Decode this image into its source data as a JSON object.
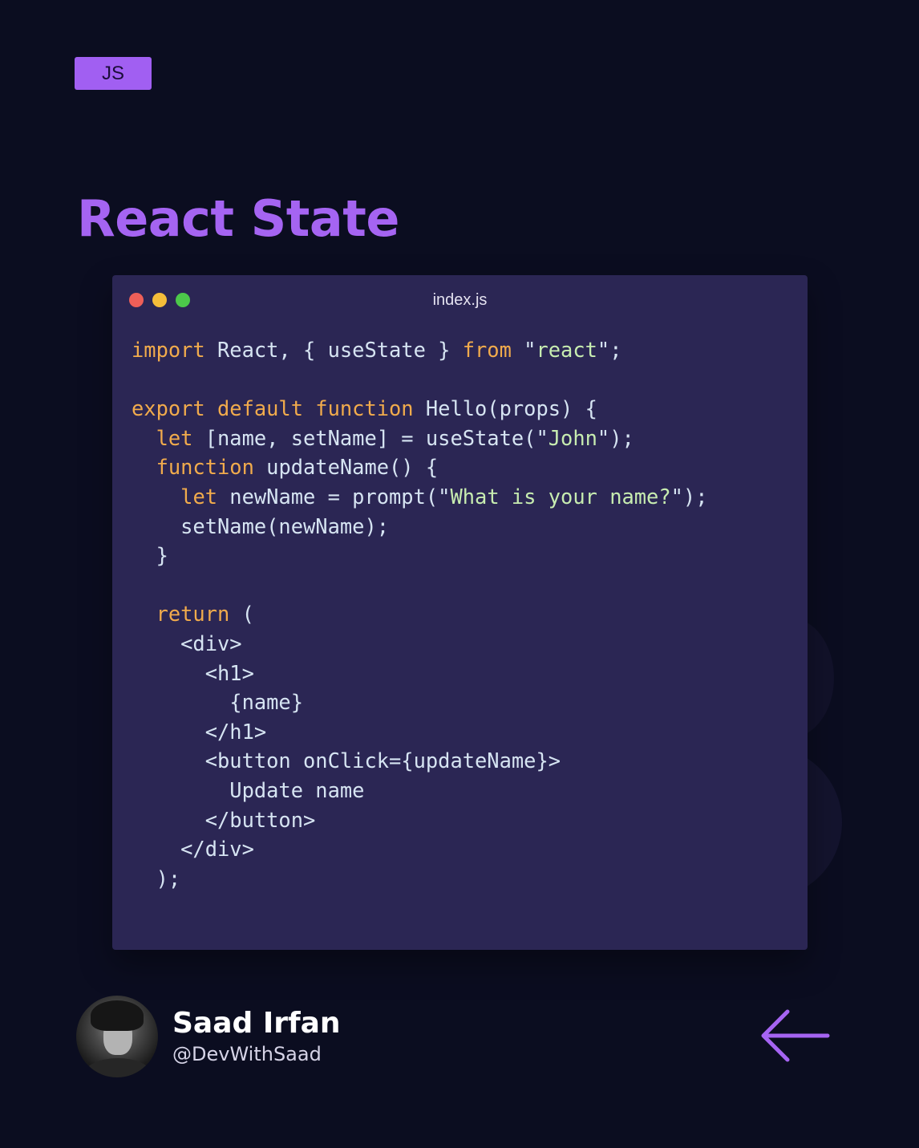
{
  "tag": {
    "label": "JS",
    "color": "#a15ff2"
  },
  "title": "React State",
  "editor": {
    "file_name": "index.js",
    "window_dots": [
      {
        "name": "close-dot",
        "color": "#ee5f58"
      },
      {
        "name": "minimize-dot",
        "color": "#f5bd3a"
      },
      {
        "name": "maximize-dot",
        "color": "#4cc84a"
      }
    ],
    "colors": {
      "keyword": "#f1ab4c",
      "text": "#d6e4f2",
      "string": "#c7ecb0",
      "background": "#2b2654"
    },
    "code_lines": [
      [
        {
          "t": "import",
          "c": "keyword"
        },
        {
          "t": " React, { useState } ",
          "c": "text"
        },
        {
          "t": "from",
          "c": "keyword"
        },
        {
          "t": " \"",
          "c": "text"
        },
        {
          "t": "react",
          "c": "string"
        },
        {
          "t": "\";",
          "c": "text"
        }
      ],
      [],
      [
        {
          "t": "export default function",
          "c": "keyword"
        },
        {
          "t": " Hello(props) {",
          "c": "text"
        }
      ],
      [
        {
          "t": "  ",
          "c": "text"
        },
        {
          "t": "let",
          "c": "keyword"
        },
        {
          "t": " [name, setName] = useState(\"",
          "c": "text"
        },
        {
          "t": "John",
          "c": "string"
        },
        {
          "t": "\");",
          "c": "text"
        }
      ],
      [
        {
          "t": "  ",
          "c": "text"
        },
        {
          "t": "function",
          "c": "keyword"
        },
        {
          "t": " updateName() {",
          "c": "text"
        }
      ],
      [
        {
          "t": "    ",
          "c": "text"
        },
        {
          "t": "let",
          "c": "keyword"
        },
        {
          "t": " newName = prompt(\"",
          "c": "text"
        },
        {
          "t": "What is your name?",
          "c": "string"
        },
        {
          "t": "\");",
          "c": "text"
        }
      ],
      [
        {
          "t": "    setName(newName);",
          "c": "text"
        }
      ],
      [
        {
          "t": "  }",
          "c": "text"
        }
      ],
      [],
      [
        {
          "t": "  ",
          "c": "text"
        },
        {
          "t": "return",
          "c": "keyword"
        },
        {
          "t": " (",
          "c": "text"
        }
      ],
      [
        {
          "t": "    <div>",
          "c": "text"
        }
      ],
      [
        {
          "t": "      <h1>",
          "c": "text"
        }
      ],
      [
        {
          "t": "        {name}",
          "c": "text"
        }
      ],
      [
        {
          "t": "      </h1>",
          "c": "text"
        }
      ],
      [
        {
          "t": "      <button onClick={updateName}>",
          "c": "text"
        }
      ],
      [
        {
          "t": "        Update name",
          "c": "text"
        }
      ],
      [
        {
          "t": "      </button>",
          "c": "text"
        }
      ],
      [
        {
          "t": "    </div>",
          "c": "text"
        }
      ],
      [
        {
          "t": "  );",
          "c": "text"
        }
      ]
    ]
  },
  "author": {
    "name": "Saad Irfan",
    "handle": "@DevWithSaad"
  },
  "navigation": {
    "icon": "arrow-left-icon",
    "color": "#a564f2"
  }
}
